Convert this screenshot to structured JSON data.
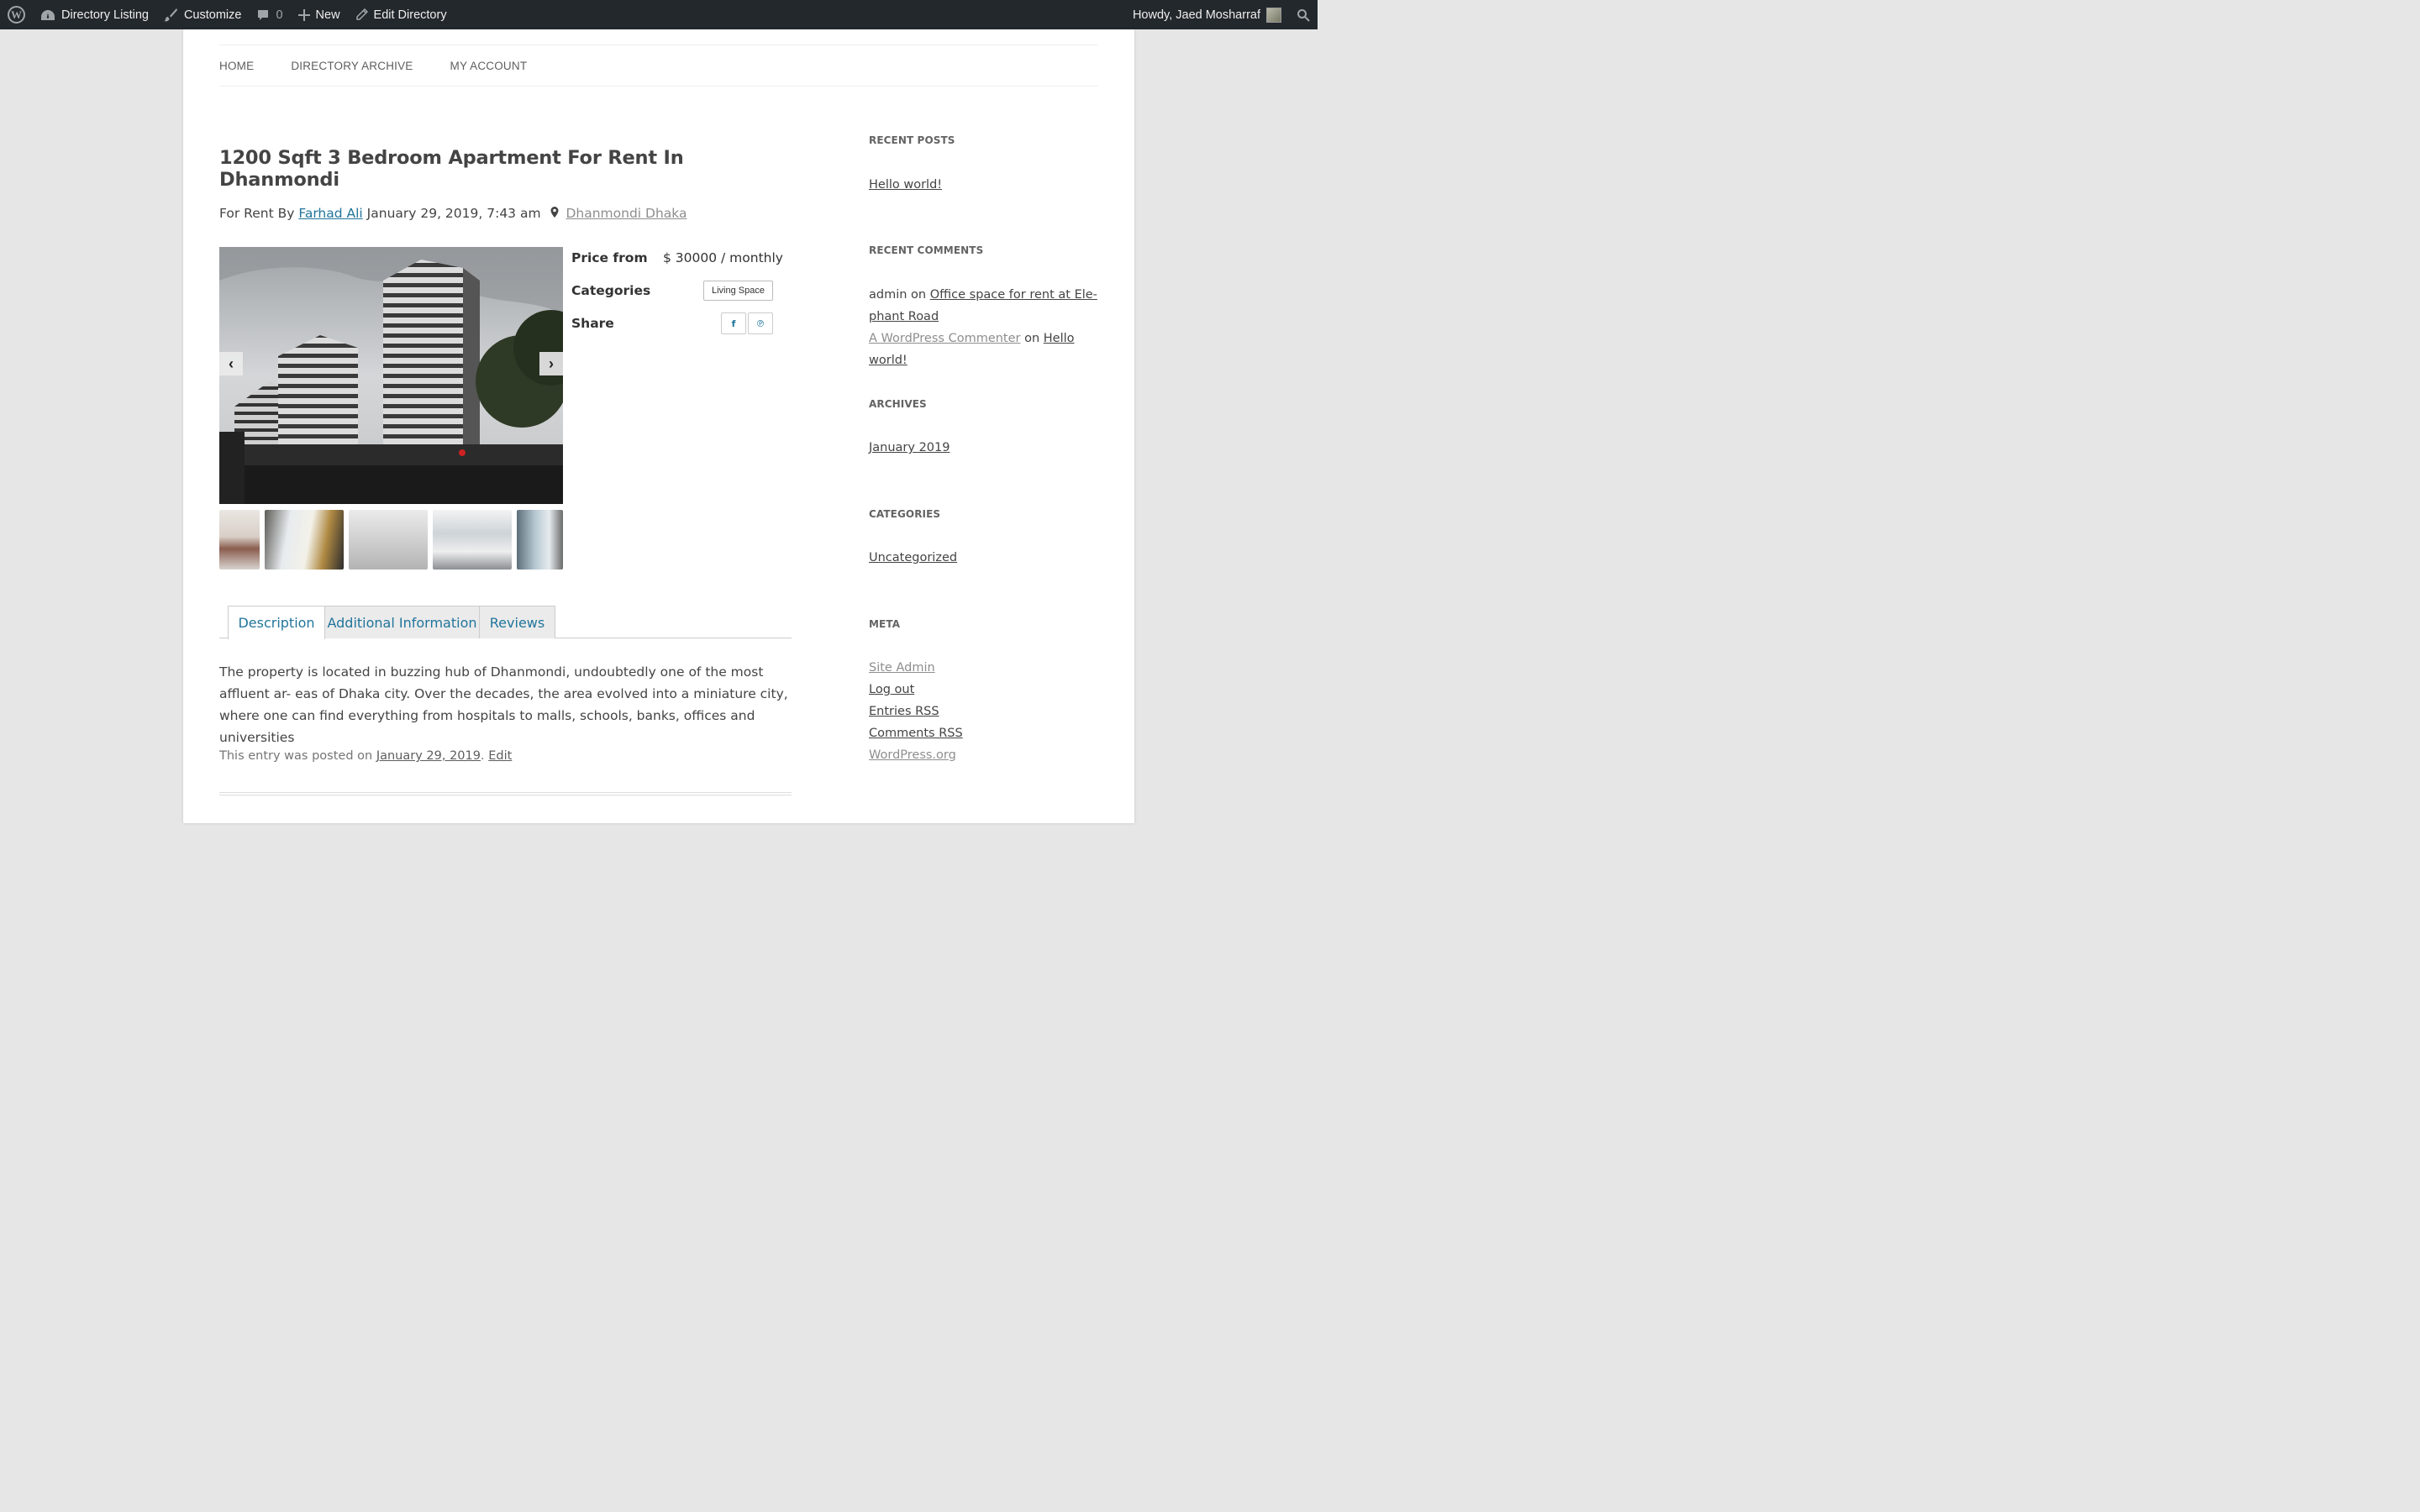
{
  "adminbar": {
    "site_name": "Directory Listing",
    "customize": "Customize",
    "comments_count": "0",
    "new": "New",
    "edit": "Edit Directory",
    "greeting": "Howdy, Jaed Mosharraf"
  },
  "nav": {
    "items": [
      "HOME",
      "DIRECTORY ARCHIVE",
      "MY ACCOUNT"
    ]
  },
  "post": {
    "title": "1200 Sqft 3 Bedroom Apartment For Rent In Dhanmondi",
    "meta_prefix": "For Rent By",
    "author": "Farhad Ali",
    "date": "January 29, 2019, 7:43 am",
    "location": "Dhanmondi Dhaka",
    "price_label": "Price from",
    "price_value": "$ 30000 / monthly",
    "categories_label": "Categories",
    "category": "Living Space",
    "share_label": "Share",
    "share_facebook": "f",
    "share_pinterest": "℗",
    "tabs": [
      "Description",
      "Additional Information",
      "Reviews"
    ],
    "description": "The property is located in buzzing hub of Dhanmondi, undoubtedly one of the most affluent ar- eas of Dhaka city. Over the decades, the area evolved into a miniature city, where one can find everything from hospitals to malls, schools, banks, offices and universities",
    "footer_prefix": "This entry was posted on",
    "footer_date": "January 29, 2019",
    "footer_edit": "Edit"
  },
  "sidebar": {
    "recent_posts_title": "RECENT POSTS",
    "recent_post": "Hello world!",
    "recent_comments_title": "RECENT COMMENTS",
    "comment1_author": "admin",
    "comment1_on": "on",
    "comment1_post": "Office space for rent at Ele- phant Road",
    "comment2_author": "A WordPress Commenter",
    "comment2_on": "on",
    "comment2_post": "Hello world!",
    "archives_title": "ARCHIVES",
    "archive": "January 2019",
    "categories_title": "CATEGORIES",
    "category": "Uncategorized",
    "meta_title": "META",
    "meta_links": [
      "Site Admin",
      "Log out",
      "Entries RSS",
      "Comments RSS",
      "WordPress.org"
    ]
  },
  "icons": {
    "wordpress": "wordpress-logo-icon",
    "dashboard": "dashboard-icon",
    "brush": "brush-icon",
    "comment": "comment-icon",
    "plus": "plus-icon",
    "pencil": "pencil-icon",
    "search": "search-icon",
    "pin": "map-pin-icon",
    "prev": "chevron-left-icon",
    "next": "chevron-right-icon"
  },
  "colors": {
    "admin_bar": "#23282d",
    "link_blue": "#21759b",
    "page_bg": "#e6e6e6"
  }
}
